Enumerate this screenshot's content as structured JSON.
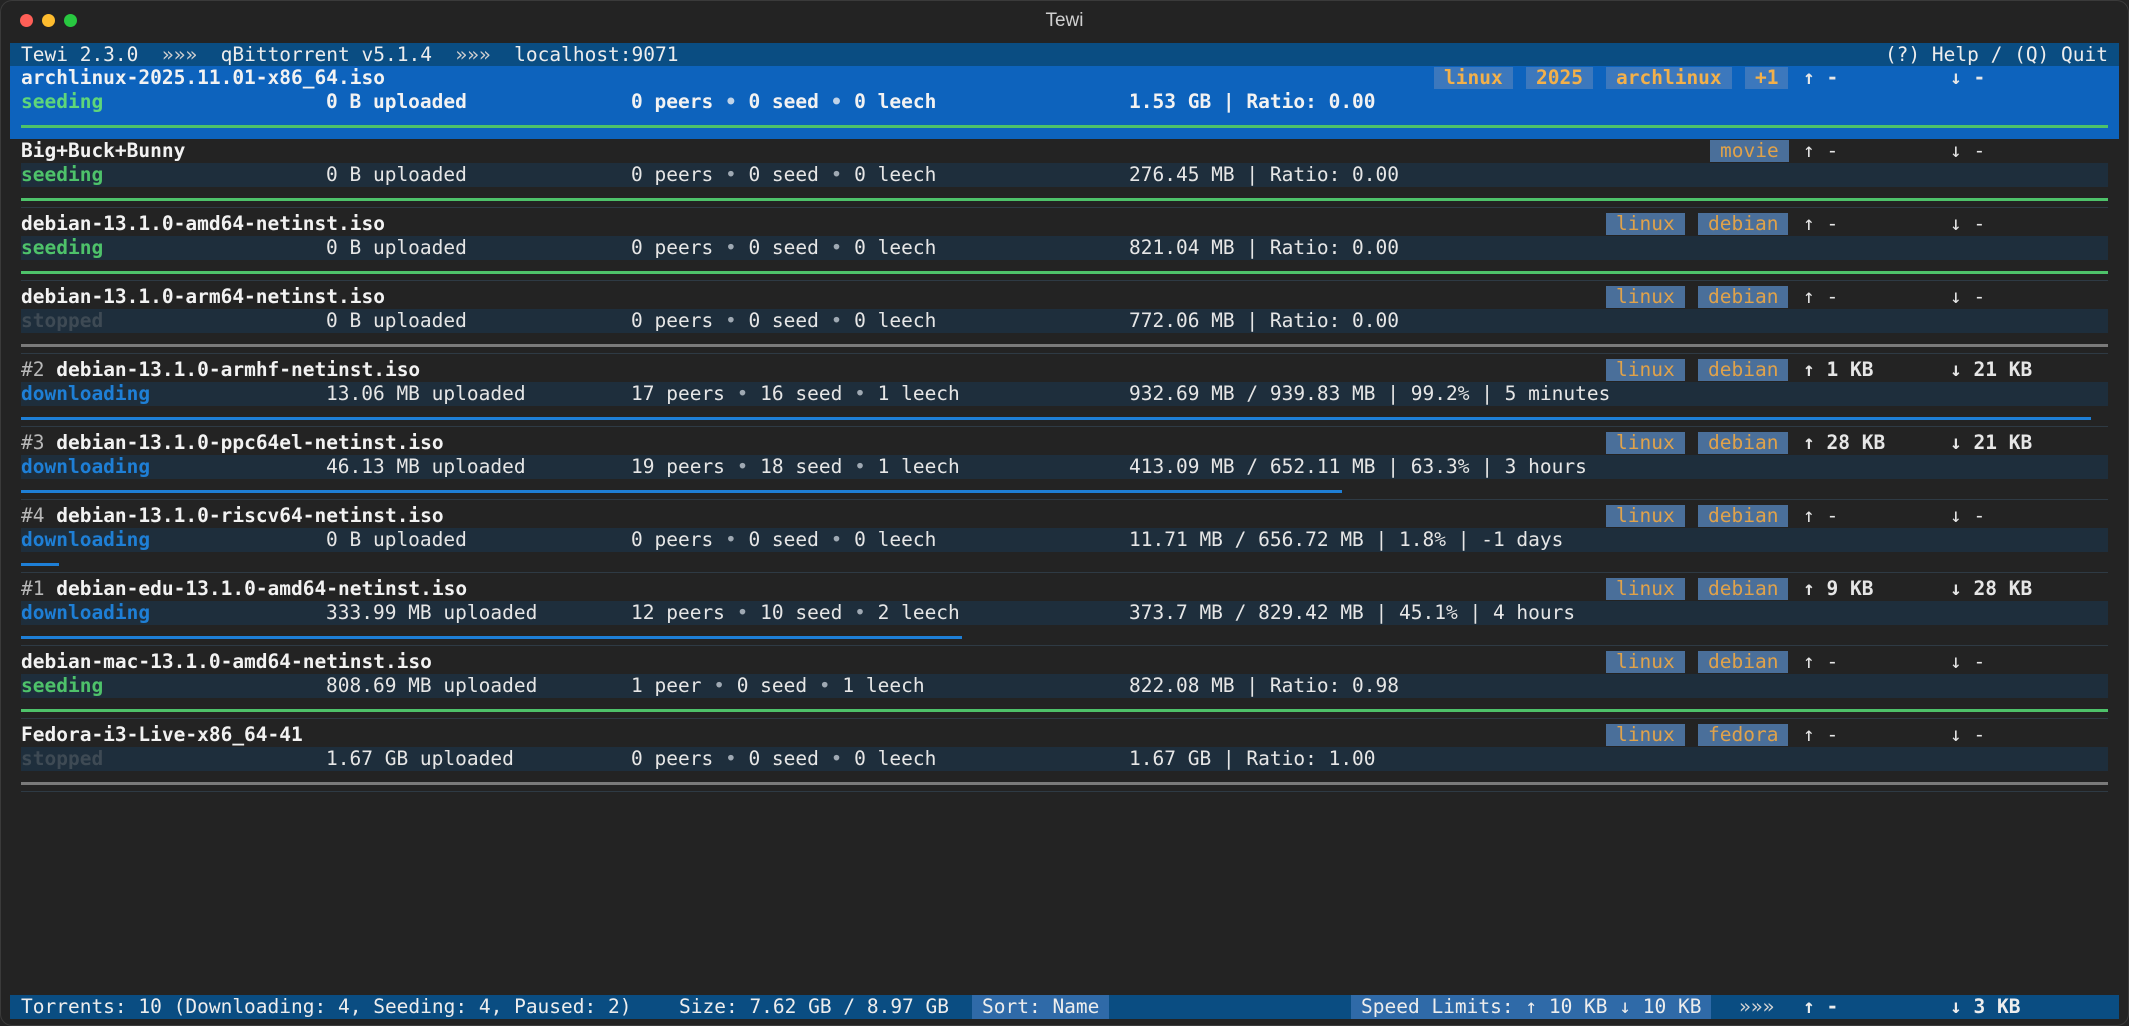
{
  "window": {
    "title": "Tewi"
  },
  "header": {
    "app": "Tewi 2.3.0",
    "sep1": "»»»",
    "client": "qBittorrent v5.1.4",
    "sep2": "»»»",
    "host": "localhost:9071",
    "help": "(?) Help / (Q) Quit"
  },
  "torrents": [
    {
      "priority": "",
      "name": "archlinux-2025.11.01-x86_64.iso",
      "status": "seeding",
      "uploaded": "0 B uploaded",
      "peers": "0 peers",
      "seeds": "0 seed",
      "leech": "0 leech",
      "bullet": "•",
      "size": "1.53 GB | Ratio: 0.00",
      "labels": [
        "linux",
        "2025",
        "archlinux",
        "+1"
      ],
      "up": "↑ -",
      "down": "↓ -",
      "progress": 1.0,
      "bar_color": "#4ec26a",
      "selected": true
    },
    {
      "priority": "",
      "name": "Big+Buck+Bunny",
      "status": "seeding",
      "uploaded": "0 B uploaded",
      "peers": "0 peers",
      "seeds": "0 seed",
      "leech": "0 leech",
      "bullet": "•",
      "size": "276.45 MB | Ratio: 0.00",
      "labels": [
        "movie"
      ],
      "up": "↑ -",
      "down": "↓ -",
      "progress": 1.0,
      "bar_color": "#4ec26a"
    },
    {
      "priority": "",
      "name": "debian-13.1.0-amd64-netinst.iso",
      "status": "seeding",
      "uploaded": "0 B uploaded",
      "peers": "0 peers",
      "seeds": "0 seed",
      "leech": "0 leech",
      "bullet": "•",
      "size": "821.04 MB | Ratio: 0.00",
      "labels": [
        "linux",
        "debian"
      ],
      "up": "↑ -",
      "down": "↓ -",
      "progress": 1.0,
      "bar_color": "#4ec26a"
    },
    {
      "priority": "",
      "name": "debian-13.1.0-arm64-netinst.iso",
      "status": "stopped",
      "uploaded": "0 B uploaded",
      "peers": "0 peers",
      "seeds": "0 seed",
      "leech": "0 leech",
      "bullet": "•",
      "size": "772.06 MB | Ratio: 0.00",
      "labels": [
        "linux",
        "debian"
      ],
      "up": "↑ -",
      "down": "↓ -",
      "progress": 1.0,
      "bar_color": "#7a7a7a"
    },
    {
      "priority": "#2",
      "name": "debian-13.1.0-armhf-netinst.iso",
      "status": "downloading",
      "uploaded": "13.06 MB uploaded",
      "peers": "17 peers",
      "seeds": "16 seed",
      "leech": "1 leech",
      "bullet": "•",
      "size": "932.69 MB / 939.83 MB | 99.2% | 5 minutes",
      "labels": [
        "linux",
        "debian"
      ],
      "up": "↑ 1 KB",
      "down": "↓ 21 KB",
      "progress": 0.992,
      "bar_color": "#1e7fd6",
      "bold_speed": true
    },
    {
      "priority": "#3",
      "name": "debian-13.1.0-ppc64el-netinst.iso",
      "status": "downloading",
      "uploaded": "46.13 MB uploaded",
      "peers": "19 peers",
      "seeds": "18 seed",
      "leech": "1 leech",
      "bullet": "•",
      "size": "413.09 MB / 652.11 MB | 63.3% | 3 hours",
      "labels": [
        "linux",
        "debian"
      ],
      "up": "↑ 28 KB",
      "down": "↓ 21 KB",
      "progress": 0.633,
      "bar_color": "#1e7fd6",
      "bold_speed": true
    },
    {
      "priority": "#4",
      "name": "debian-13.1.0-riscv64-netinst.iso",
      "status": "downloading",
      "uploaded": "0 B uploaded",
      "peers": "0 peers",
      "seeds": "0 seed",
      "leech": "0 leech",
      "bullet": "•",
      "size": "11.71 MB / 656.72 MB | 1.8% | -1 days",
      "labels": [
        "linux",
        "debian"
      ],
      "up": "↑ -",
      "down": "↓ -",
      "progress": 0.018,
      "bar_color": "#1e7fd6"
    },
    {
      "priority": "#1",
      "name": "debian-edu-13.1.0-amd64-netinst.iso",
      "status": "downloading",
      "uploaded": "333.99 MB uploaded",
      "peers": "12 peers",
      "seeds": "10 seed",
      "leech": "2 leech",
      "bullet": "•",
      "size": "373.7 MB / 829.42 MB | 45.1% | 4 hours",
      "labels": [
        "linux",
        "debian"
      ],
      "up": "↑ 9 KB",
      "down": "↓ 28 KB",
      "progress": 0.451,
      "bar_color": "#1e7fd6",
      "bold_speed": true
    },
    {
      "priority": "",
      "name": "debian-mac-13.1.0-amd64-netinst.iso",
      "status": "seeding",
      "uploaded": "808.69 MB uploaded",
      "peers": "1 peer",
      "seeds": "0 seed",
      "leech": "1 leech",
      "bullet": "•",
      "size": "822.08 MB | Ratio: 0.98",
      "labels": [
        "linux",
        "debian"
      ],
      "up": "↑ -",
      "down": "↓ -",
      "progress": 1.0,
      "bar_color": "#4ec26a"
    },
    {
      "priority": "",
      "name": "Fedora-i3-Live-x86_64-41",
      "status": "stopped",
      "uploaded": "1.67 GB uploaded",
      "peers": "0 peers",
      "seeds": "0 seed",
      "leech": "0 leech",
      "bullet": "•",
      "size": "1.67 GB | Ratio: 1.00",
      "labels": [
        "linux",
        "fedora"
      ],
      "up": "↑ -",
      "down": "↓ -",
      "progress": 1.0,
      "bar_color": "#7a7a7a"
    }
  ],
  "footer": {
    "summary": "Torrents: 10 (Downloading: 4, Seeding: 4, Paused: 2)",
    "size": "Size: 7.62 GB / 8.97 GB",
    "sort": "Sort: Name",
    "limits": "Speed Limits: ↑ 10 KB ↓ 10 KB",
    "sep": "»»»",
    "up": "↑ -",
    "down": "↓ 3 KB"
  }
}
